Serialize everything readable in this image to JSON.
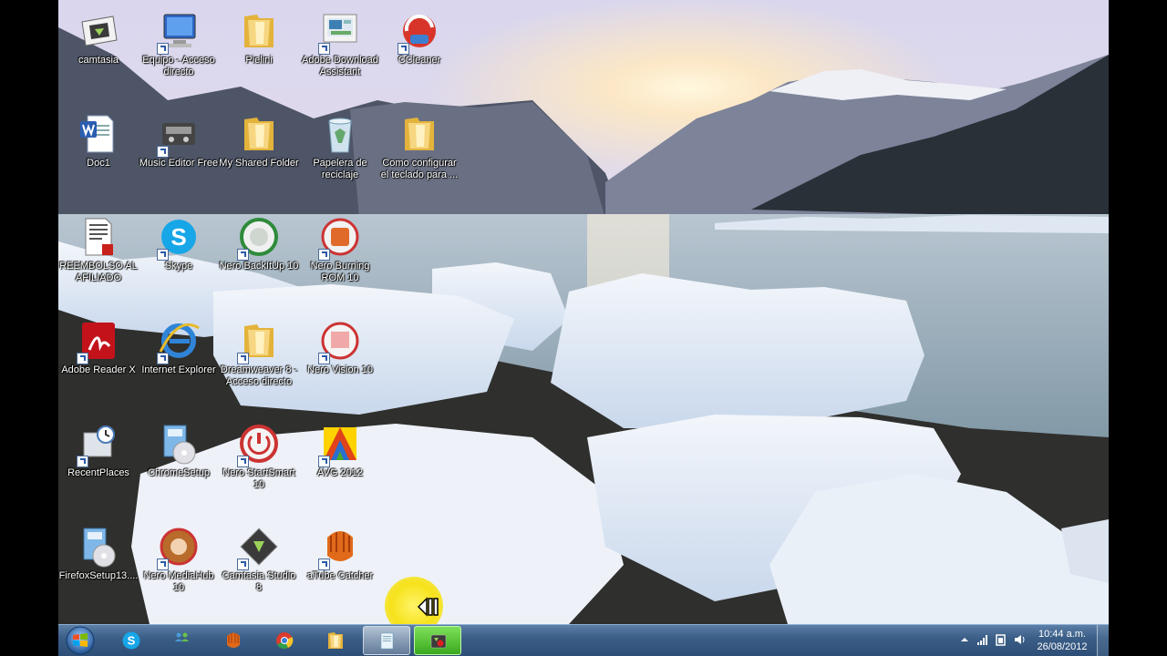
{
  "desktop": {
    "icons": [
      {
        "label": "camtasia",
        "icon": "camtasia-folder-icon",
        "shortcut": false
      },
      {
        "label": "Equipo - Acceso directo",
        "icon": "computer-icon",
        "shortcut": true
      },
      {
        "label": "Pielini",
        "icon": "folder-icon",
        "shortcut": false
      },
      {
        "label": "Adobe Download Assistant",
        "icon": "adobe-download-icon",
        "shortcut": true
      },
      {
        "label": "CCleaner",
        "icon": "ccleaner-icon",
        "shortcut": true
      },
      {
        "label": "Doc1",
        "icon": "word-document-icon",
        "shortcut": false
      },
      {
        "label": "Music Editor Free",
        "icon": "music-editor-icon",
        "shortcut": true
      },
      {
        "label": "My Shared Folder",
        "icon": "folder-icon",
        "shortcut": false
      },
      {
        "label": "Papelera de reciclaje",
        "icon": "recycle-bin-icon",
        "shortcut": false
      },
      {
        "label": "Como configurar el teclado para ...",
        "icon": "folder-icon",
        "shortcut": false
      },
      {
        "label": "REEMBOLSO AL AFILIADO",
        "icon": "pdf-document-icon",
        "shortcut": false
      },
      {
        "label": "Skype",
        "icon": "skype-icon",
        "shortcut": true
      },
      {
        "label": "Nero BackItUp 10",
        "icon": "nero-backitup-icon",
        "shortcut": true
      },
      {
        "label": "Nero Burning ROM 10",
        "icon": "nero-burning-rom-icon",
        "shortcut": true
      },
      {
        "label": "Adobe Reader X",
        "icon": "adobe-reader-icon",
        "shortcut": true
      },
      {
        "label": "Internet Explorer",
        "icon": "internet-explorer-icon",
        "shortcut": true
      },
      {
        "label": "Dreamweaver 8 - Acceso directo",
        "icon": "folder-icon",
        "shortcut": true
      },
      {
        "label": "Nero Vision 10",
        "icon": "nero-vision-icon",
        "shortcut": true
      },
      {
        "label": "RecentPlaces",
        "icon": "recent-places-icon",
        "shortcut": true
      },
      {
        "label": "ChromeSetup",
        "icon": "setup-installer-icon",
        "shortcut": false
      },
      {
        "label": "Nero StartSmart 10",
        "icon": "nero-startsmart-icon",
        "shortcut": true
      },
      {
        "label": "AVG 2012",
        "icon": "avg-icon",
        "shortcut": true
      },
      {
        "label": "FirefoxSetup13....",
        "icon": "setup-installer-icon",
        "shortcut": false
      },
      {
        "label": "Nero MediaHub 10",
        "icon": "nero-mediahub-icon",
        "shortcut": true
      },
      {
        "label": "Camtasia Studio 8",
        "icon": "camtasia-studio-icon",
        "shortcut": true
      },
      {
        "label": "aTube Catcher",
        "icon": "atube-catcher-icon",
        "shortcut": true
      }
    ]
  },
  "taskbar": {
    "start_icon": "windows-start-icon",
    "pinned": [
      {
        "name": "taskbar-skype",
        "icon": "skype-icon"
      },
      {
        "name": "taskbar-network-users",
        "icon": "network-users-icon"
      },
      {
        "name": "taskbar-atube-catcher",
        "icon": "atube-catcher-icon"
      },
      {
        "name": "taskbar-chrome",
        "icon": "chrome-icon"
      },
      {
        "name": "taskbar-explorer",
        "icon": "folder-icon"
      },
      {
        "name": "taskbar-notepad",
        "icon": "notepad-icon"
      },
      {
        "name": "taskbar-camtasia-recorder",
        "icon": "camtasia-recorder-icon"
      }
    ],
    "clock": {
      "time": "10:44 a.m.",
      "date": "26/08/2012"
    }
  },
  "colors": {
    "taskbar": "#3b5f88",
    "cursor_highlight": "#f6e21a"
  }
}
